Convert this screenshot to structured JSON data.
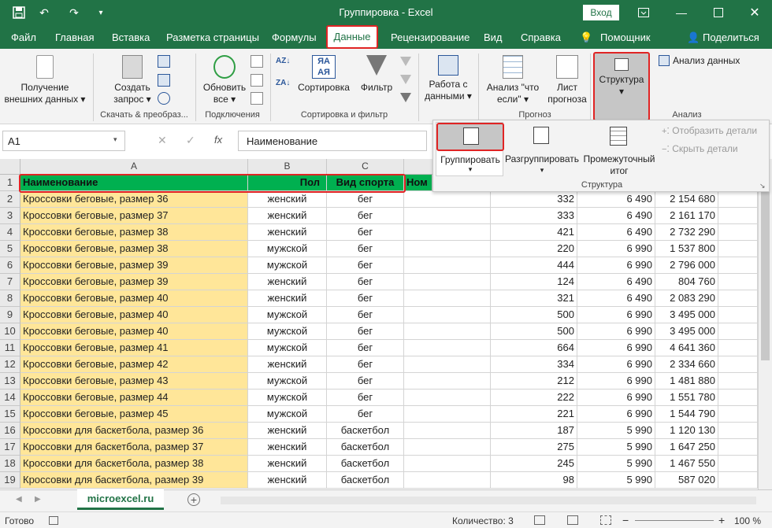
{
  "window": {
    "title": "Группировка  -  Excel",
    "login_label": "Вход"
  },
  "menu": {
    "tabs": [
      "Файл",
      "Главная",
      "Вставка",
      "Разметка страницы",
      "Формулы",
      "Данные",
      "Рецензирование",
      "Вид",
      "Справка",
      "Помощник",
      "Поделиться"
    ],
    "active": "Данные"
  },
  "ribbon": {
    "get_data": "Получение внешних данных",
    "create_query": "Создать запрос",
    "group_download": "Скачать & преобраз...",
    "refresh_all": "Обновить все",
    "group_connections": "Подключения",
    "sort": "Сортировка",
    "filter": "Фильтр",
    "group_sort": "Сортировка и фильтр",
    "data_tools": "Работа с данными",
    "whatif": "Анализ \"что если\"",
    "forecast_sheet": "Лист прогноза",
    "group_forecast": "Прогноз",
    "structure": "Структура",
    "data_analysis": "Анализ данных",
    "group_analysis": "Анализ"
  },
  "structure_dropdown": {
    "group": "Группировать",
    "ungroup": "Разгруппировать",
    "subtotal": "Промежуточный итог",
    "show_detail": "Отобразить детали",
    "hide_detail": "Скрыть детали",
    "caption": "Структура"
  },
  "formula_bar": {
    "name_box": "A1",
    "fx": "fx",
    "content": "Наименование"
  },
  "columns": [
    "A",
    "B",
    "C"
  ],
  "header_row": [
    "Наименование",
    "Пол",
    "Вид спорта",
    "Ном"
  ],
  "rows": [
    {
      "n": "2",
      "a": "Кроссовки беговые, размер 36",
      "b": "женский",
      "c": "бег",
      "e": "332",
      "f": "6 490",
      "g": "2 154 680"
    },
    {
      "n": "3",
      "a": "Кроссовки беговые, размер 37",
      "b": "женский",
      "c": "бег",
      "e": "333",
      "f": "6 490",
      "g": "2 161 170"
    },
    {
      "n": "4",
      "a": "Кроссовки беговые, размер 38",
      "b": "женский",
      "c": "бег",
      "e": "421",
      "f": "6 490",
      "g": "2 732 290"
    },
    {
      "n": "5",
      "a": "Кроссовки беговые, размер 38",
      "b": "мужской",
      "c": "бег",
      "e": "220",
      "f": "6 990",
      "g": "1 537 800"
    },
    {
      "n": "6",
      "a": "Кроссовки беговые, размер 39",
      "b": "мужской",
      "c": "бег",
      "e": "444",
      "f": "6 990",
      "g": "2 796 000"
    },
    {
      "n": "7",
      "a": "Кроссовки беговые, размер 39",
      "b": "женский",
      "c": "бег",
      "e": "124",
      "f": "6 490",
      "g": "804 760"
    },
    {
      "n": "8",
      "a": "Кроссовки беговые, размер 40",
      "b": "женский",
      "c": "бег",
      "e": "321",
      "f": "6 490",
      "g": "2 083 290"
    },
    {
      "n": "9",
      "a": "Кроссовки беговые, размер 40",
      "b": "мужской",
      "c": "бег",
      "e": "500",
      "f": "6 990",
      "g": "3 495 000"
    },
    {
      "n": "10",
      "a": "Кроссовки беговые, размер 40",
      "b": "мужской",
      "c": "бег",
      "e": "500",
      "f": "6 990",
      "g": "3 495 000"
    },
    {
      "n": "11",
      "a": "Кроссовки беговые, размер 41",
      "b": "мужской",
      "c": "бег",
      "e": "664",
      "f": "6 990",
      "g": "4 641 360"
    },
    {
      "n": "12",
      "a": "Кроссовки беговые, размер 42",
      "b": "женский",
      "c": "бег",
      "e": "334",
      "f": "6 990",
      "g": "2 334 660"
    },
    {
      "n": "13",
      "a": "Кроссовки беговые, размер 43",
      "b": "мужской",
      "c": "бег",
      "e": "212",
      "f": "6 990",
      "g": "1 481 880"
    },
    {
      "n": "14",
      "a": "Кроссовки беговые, размер 44",
      "b": "мужской",
      "c": "бег",
      "e": "222",
      "f": "6 990",
      "g": "1 551 780"
    },
    {
      "n": "15",
      "a": "Кроссовки беговые, размер 45",
      "b": "мужской",
      "c": "бег",
      "e": "221",
      "f": "6 990",
      "g": "1 544 790"
    },
    {
      "n": "16",
      "a": "Кроссовки для баскетбола, размер 36",
      "b": "женский",
      "c": "баскетбол",
      "e": "187",
      "f": "5 990",
      "g": "1 120 130"
    },
    {
      "n": "17",
      "a": "Кроссовки для баскетбола, размер 37",
      "b": "женский",
      "c": "баскетбол",
      "e": "275",
      "f": "5 990",
      "g": "1 647 250"
    },
    {
      "n": "18",
      "a": "Кроссовки для баскетбола, размер 38",
      "b": "женский",
      "c": "баскетбол",
      "e": "245",
      "f": "5 990",
      "g": "1 467 550"
    },
    {
      "n": "19",
      "a": "Кроссовки для баскетбола, размер 39",
      "b": "женский",
      "c": "баскетбол",
      "e": "98",
      "f": "5 990",
      "g": "587 020"
    }
  ],
  "sheet": {
    "tab": "microexcel.ru"
  },
  "status": {
    "ready": "Готово",
    "count": "Количество: 3",
    "zoom": "100 %"
  },
  "colors": {
    "excel_green": "#217346",
    "highlight_red": "#e02424",
    "header_fill": "#00b050",
    "name_fill": "#ffe699"
  }
}
